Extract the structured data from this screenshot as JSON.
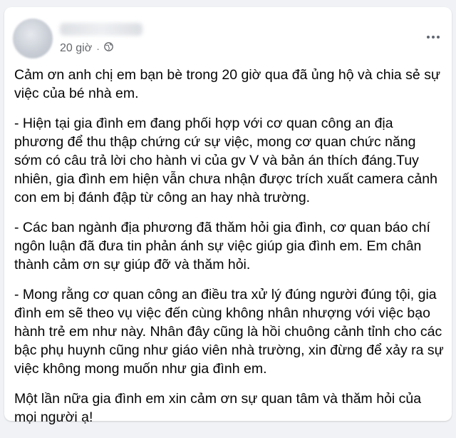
{
  "post": {
    "author_name": "",
    "timestamp": "20 giờ",
    "separator": "·",
    "privacy_icon": "globe-icon",
    "more_icon": "more-options-icon",
    "paragraphs": [
      "Cảm ơn anh chị em bạn bè trong 20 giờ qua đã ủng hộ và chia sẻ sự việc của bé nhà em.",
      "- Hiện tại gia đình em đang phối hợp với cơ quan công an địa phương để thu thập chứng cứ sự việc, mong cơ quan chức năng sớm có câu trả lời cho hành vi của gv V và bản án thích đáng.Tuy nhiên, gia đình em hiện vẫn chưa nhận được trích xuất camera cảnh con em bị đánh đập từ công an hay nhà trường.",
      "- Các ban ngành địa phương đã thăm hỏi gia đình, cơ quan báo chí ngôn luận đã đưa tin phản ánh sự việc giúp gia đình em. Em chân thành cảm ơn sự giúp đỡ và thăm hỏi.",
      "- Mong rằng cơ quan công an điều tra xử lý đúng người đúng tội, gia đình em sẽ theo vụ việc đến cùng không nhân nhượng với việc bạo hành trẻ em như này. Nhân đây cũng là hồi chuông cảnh tỉnh cho các bậc phụ huynh cũng như giáo viên nhà trường, xin đừng để xảy ra sự việc không mong muốn như gia đình em.",
      "Một lần nữa gia đình em xin cảm ơn sự quan tâm và thăm hỏi của mọi người ạ!"
    ]
  }
}
